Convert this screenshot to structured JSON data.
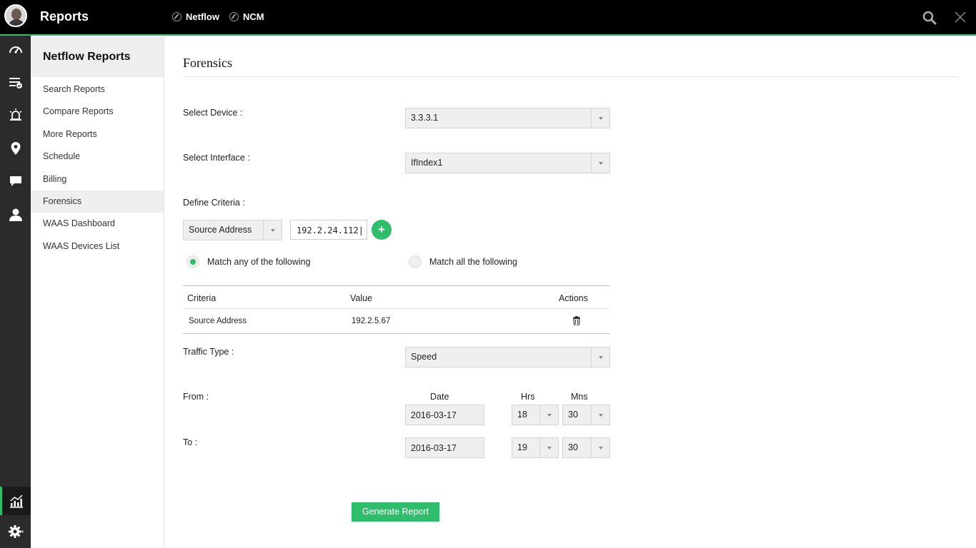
{
  "header": {
    "title": "Reports",
    "tabs": [
      {
        "label": "Netflow",
        "icon": "compass-icon"
      },
      {
        "label": "NCM",
        "icon": "compass-icon"
      }
    ]
  },
  "rail": {
    "items": [
      "dashboard-icon",
      "tasks-icon",
      "alarm-icon",
      "map-pin-icon",
      "chat-icon",
      "user-icon",
      "reports-chart-icon",
      "settings-icon"
    ],
    "active": "reports-chart-icon"
  },
  "subnav": {
    "header": "Netflow Reports",
    "items": [
      {
        "label": "Search Reports"
      },
      {
        "label": "Compare Reports"
      },
      {
        "label": "More Reports"
      },
      {
        "label": "Schedule"
      },
      {
        "label": "Billing"
      },
      {
        "label": "Forensics",
        "active": true
      },
      {
        "label": "WAAS Dashboard"
      },
      {
        "label": "WAAS Devices List"
      }
    ]
  },
  "form": {
    "title": "Forensics",
    "select_device_label": "Select Device :",
    "select_device_value": "3.3.3.1",
    "select_interface_label": "Select Interface :",
    "select_interface_value": "IfIndex1",
    "define_criteria_label": "Define Criteria :",
    "criteria_type_value": "Source Address",
    "criteria_input_value": "192.2.24.112|",
    "add_label": "+",
    "match_any_label": "Match any of the following",
    "match_all_label": "Match all the following",
    "match_selected": "any",
    "table": {
      "headers": [
        "Criteria",
        "Value",
        "Actions"
      ],
      "rows": [
        {
          "criteria": "Source Address",
          "value": "192.2.5.67"
        }
      ]
    },
    "traffic_type_label": "Traffic Type :",
    "traffic_type_value": "Speed",
    "from_label": "From :",
    "to_label": "To :",
    "date_col": "Date",
    "hrs_col": "Hrs",
    "mns_col": "Mns",
    "from_date": "2016-03-17",
    "from_hrs": "18",
    "from_mns": "30",
    "to_date": "2016-03-17",
    "to_hrs": "19",
    "to_mns": "30",
    "generate_label": "Generate Report"
  },
  "colors": {
    "accent": "#2ebd6b",
    "header_bg": "#000000",
    "rail_bg": "#2b2b2b"
  }
}
